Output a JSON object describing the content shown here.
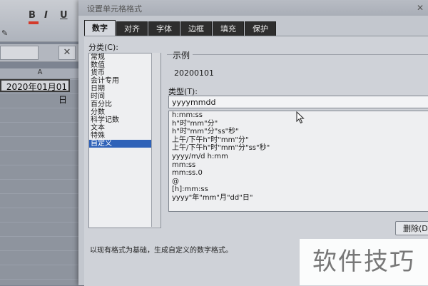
{
  "excel": {
    "ribbon": {
      "bold": "B",
      "italic": "I",
      "underline": "U"
    },
    "cancel_symbol": "✕",
    "column_a": "A",
    "cell_value": "2020年01月01日"
  },
  "dialog": {
    "title": "设置单元格格式",
    "tabs": [
      "数字",
      "对齐",
      "字体",
      "边框",
      "填充",
      "保护"
    ],
    "category_label": "分类(C):",
    "categories": [
      "常规",
      "数值",
      "货币",
      "会计专用",
      "日期",
      "时间",
      "百分比",
      "分数",
      "科学记数",
      "文本",
      "特殊",
      "自定义"
    ],
    "selected_category_index": 11,
    "sample_label": "示例",
    "sample_value": "20200101",
    "type_label": "类型(T):",
    "type_value": "yyyymmdd",
    "formats": [
      "h:mm:ss",
      "h\"时\"mm\"分\"",
      "h\"时\"mm\"分\"ss\"秒\"",
      "上午/下午h\"时\"mm\"分\"",
      "上午/下午h\"时\"mm\"分\"ss\"秒\"",
      "yyyy/m/d h:mm",
      "mm:ss",
      "mm:ss.0",
      "@",
      "[h]:mm:ss",
      "yyyy\"年\"mm\"月\"dd\"日\""
    ],
    "delete_label": "删除(D)",
    "hint": "以现有格式为基础，生成自定义的数字格式。"
  },
  "watermark": "软件技巧"
}
